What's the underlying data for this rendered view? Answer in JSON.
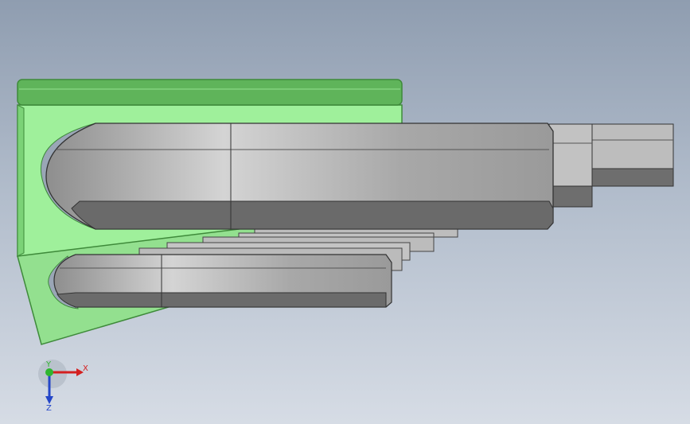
{
  "viewport": {
    "background_top": "#8f9db0",
    "background_bottom": "#d6dce5"
  },
  "model": {
    "holder_color": "#9de89a",
    "holder_edge_color": "#3e8a3a",
    "wrench_color": "#b4b4b4",
    "wrench_shadow_color": "#6a6a6a"
  },
  "triad": {
    "x_label": "X",
    "y_label": "Y",
    "z_label": "Z",
    "x_color": "#d42020",
    "y_color": "#2fb52f",
    "z_color": "#2446c8"
  }
}
